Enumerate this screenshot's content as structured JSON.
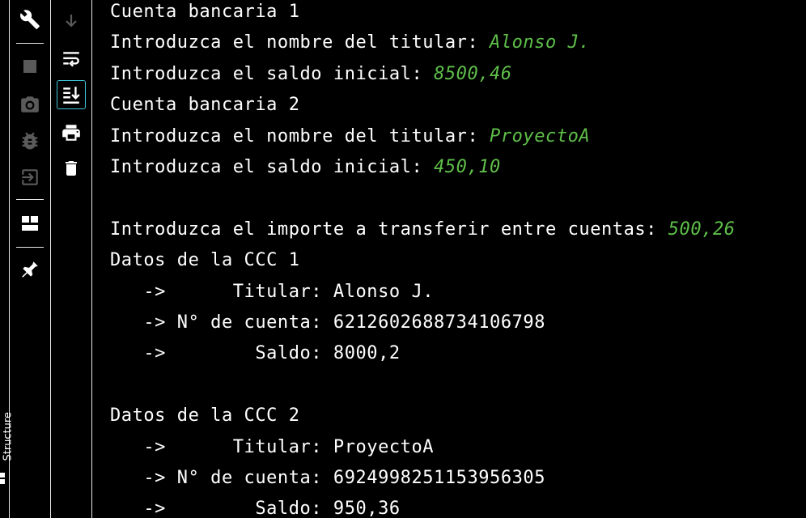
{
  "side_panel": {
    "vertical_label": "Structure"
  },
  "toolbar1": {
    "icons": [
      "wrench-icon",
      "stop-icon",
      "camera-icon",
      "debug-icon",
      "exit-icon",
      "layout-icon",
      "pin-icon"
    ]
  },
  "toolbar2": {
    "icons": [
      "scroll-down-icon",
      "soft-wrap-icon",
      "scroll-to-end-icon",
      "print-icon",
      "trash-icon"
    ]
  },
  "console": {
    "colors": {
      "output": "#ffffff",
      "input": "#5fbf4a",
      "background": "#000000"
    },
    "lines": [
      {
        "prompt": "Cuenta bancaria 1",
        "input": ""
      },
      {
        "prompt": "Introduzca el nombre del titular: ",
        "input": "Alonso J."
      },
      {
        "prompt": "Introduzca el saldo inicial: ",
        "input": "8500,46"
      },
      {
        "prompt": "Cuenta bancaria 2",
        "input": ""
      },
      {
        "prompt": "Introduzca el nombre del titular: ",
        "input": "ProyectoA"
      },
      {
        "prompt": "Introduzca el saldo inicial: ",
        "input": "450,10"
      },
      {
        "prompt": "",
        "input": ""
      },
      {
        "prompt": "Introduzca el importe a transferir entre cuentas: ",
        "input": "500,26"
      },
      {
        "prompt": "Datos de la CCC 1",
        "input": ""
      },
      {
        "prompt": "   ->      Titular: Alonso J.",
        "input": ""
      },
      {
        "prompt": "   -> N° de cuenta: 6212602688734106798",
        "input": ""
      },
      {
        "prompt": "   ->        Saldo: 8000,2",
        "input": ""
      },
      {
        "prompt": "",
        "input": ""
      },
      {
        "prompt": "Datos de la CCC 2",
        "input": ""
      },
      {
        "prompt": "   ->      Titular: ProyectoA",
        "input": ""
      },
      {
        "prompt": "   -> N° de cuenta: 6924998251153956305",
        "input": ""
      },
      {
        "prompt": "   ->        Saldo: 950,36",
        "input": ""
      }
    ]
  }
}
